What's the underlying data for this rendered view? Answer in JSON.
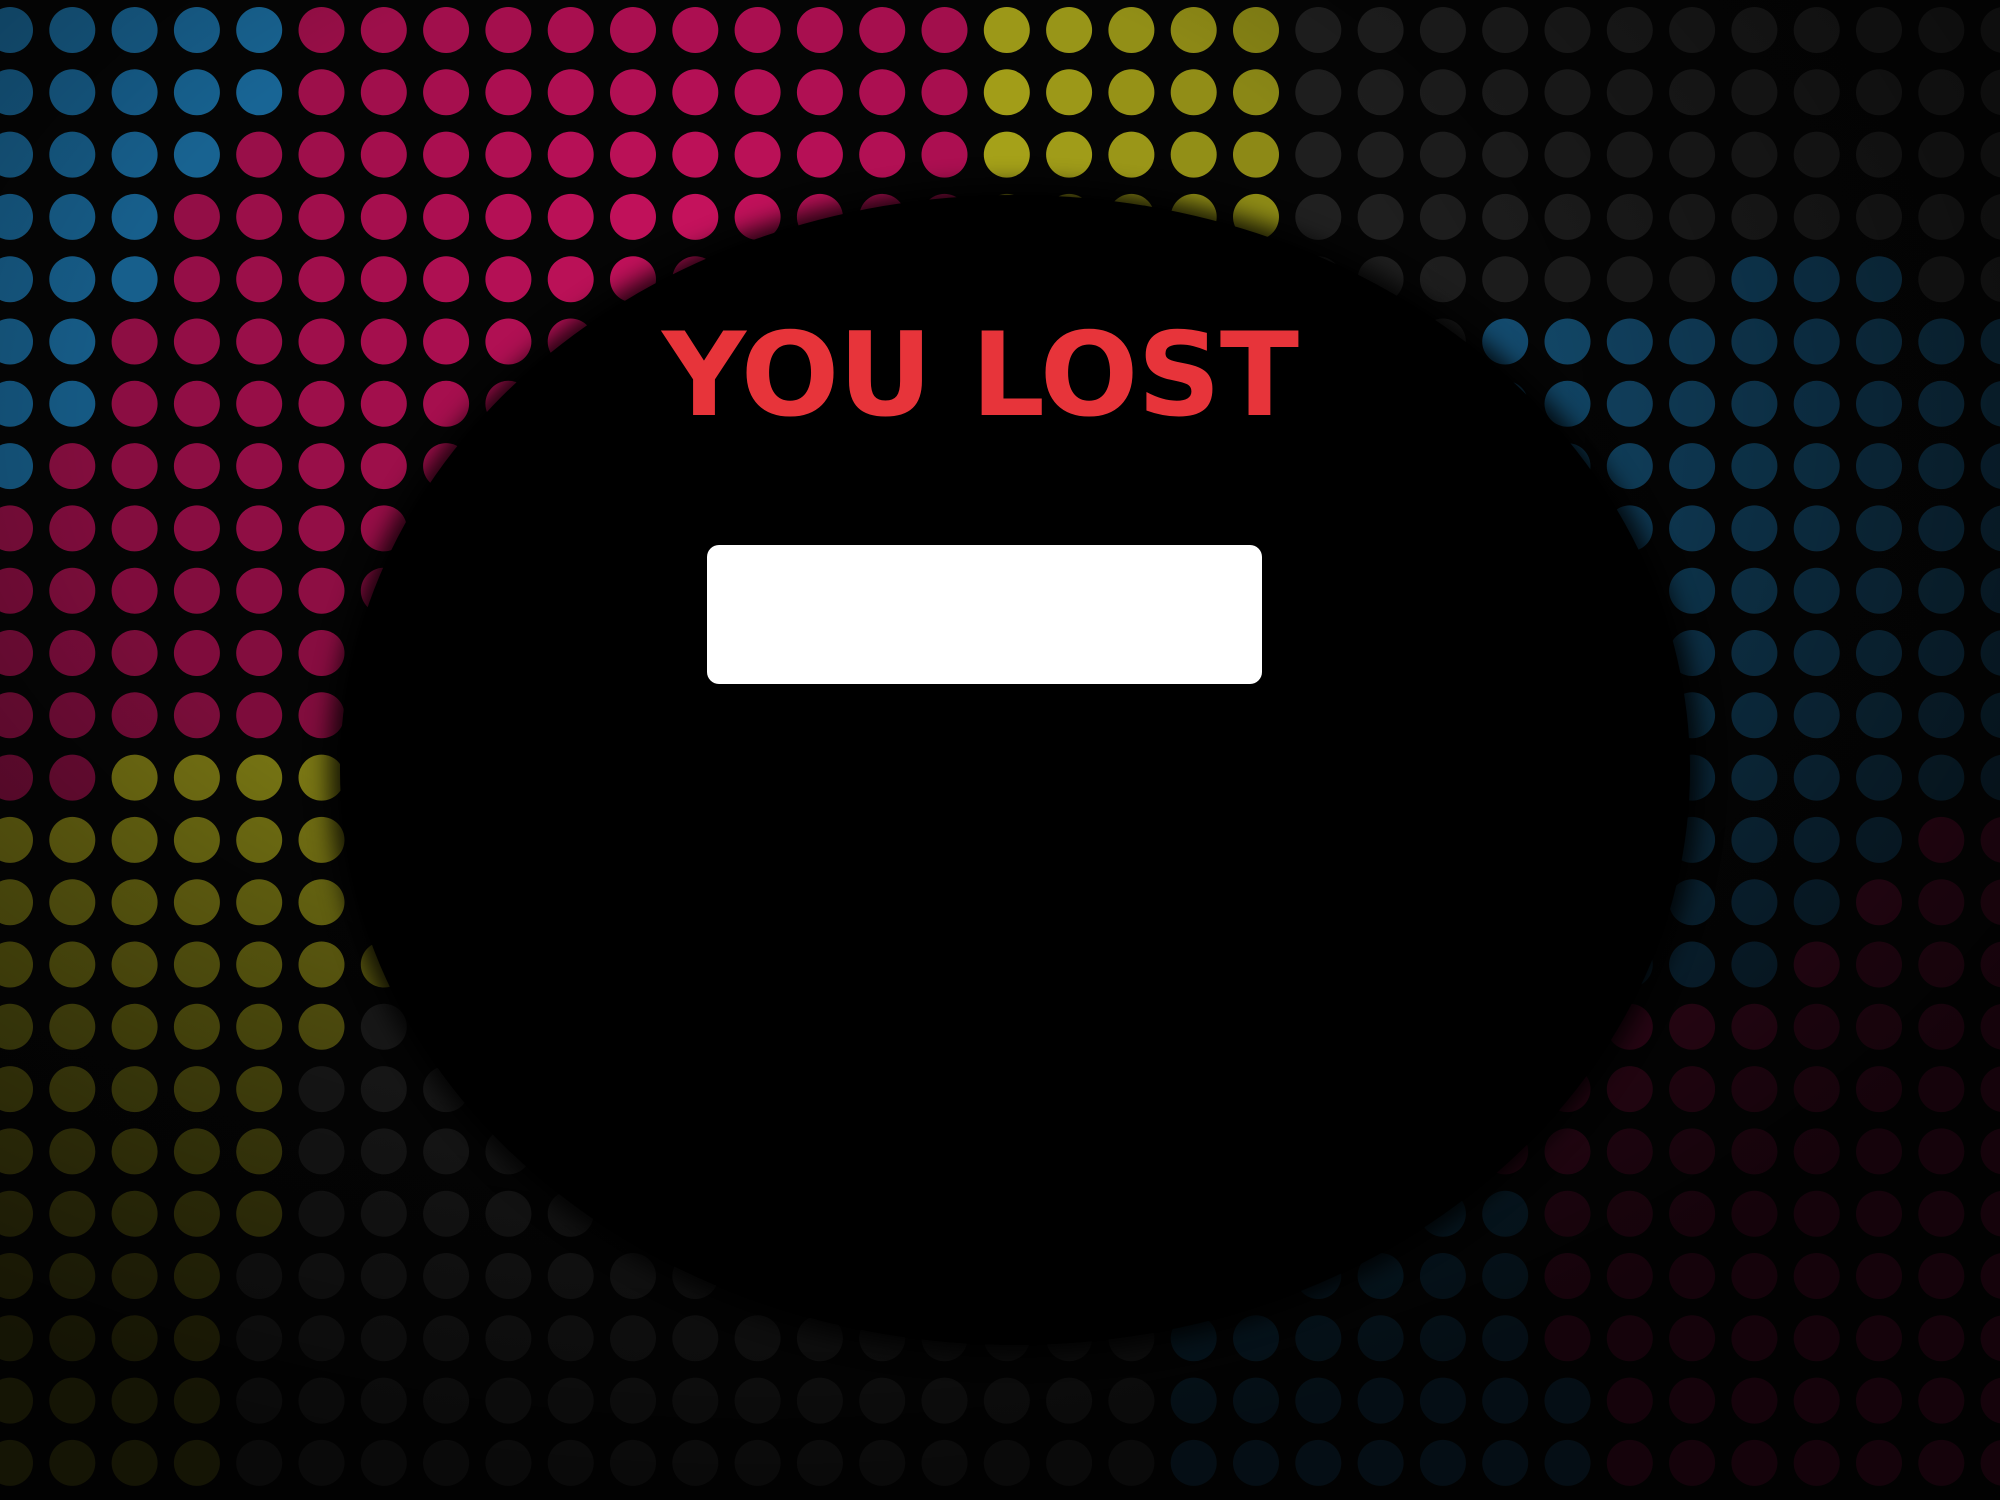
{
  "screen": {
    "title": "YOU LOST",
    "title_color": "#e7343a",
    "name_input": {
      "value": "",
      "placeholder": ""
    }
  },
  "background": {
    "pattern": "dot-grid",
    "colors": {
      "blue": "#1f86c6",
      "magenta": "#c8125e",
      "yellow": "#c7c21e",
      "gray": "#2c2c2c",
      "base": "#050505"
    }
  }
}
